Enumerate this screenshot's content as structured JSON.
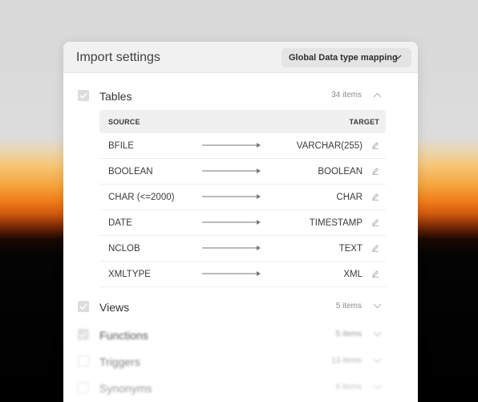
{
  "panel": {
    "title": "Import settings",
    "mapping_dropdown": "Global Data type mapping"
  },
  "sections": [
    {
      "name": "Tables",
      "count": "34 items",
      "checked": true,
      "expanded": true
    },
    {
      "name": "Views",
      "count": "5 items",
      "checked": true,
      "expanded": false
    },
    {
      "name": "Functions",
      "count": "5 items",
      "checked": true,
      "expanded": false
    },
    {
      "name": "Triggers",
      "count": "13 items",
      "checked": false,
      "expanded": false
    },
    {
      "name": "Synonyms",
      "count": "6 items",
      "checked": false,
      "expanded": false
    }
  ],
  "mapping_table": {
    "header_source": "SOURCE",
    "header_target": "TARGET",
    "rows": [
      {
        "source": "BFILE",
        "target": "VARCHAR(255)"
      },
      {
        "source": "BOOLEAN",
        "target": "BOOLEAN"
      },
      {
        "source": "CHAR (<=2000)",
        "target": "CHAR"
      },
      {
        "source": "DATE",
        "target": "TIMESTAMP"
      },
      {
        "source": "NCLOB",
        "target": "TEXT"
      },
      {
        "source": "XMLTYPE",
        "target": "XML"
      }
    ]
  },
  "icons": {
    "checkbox": "check-icon",
    "expand": "chevron-up-icon",
    "collapse": "chevron-down-icon",
    "mapping": "arrow-right-icon",
    "edit": "pencil-icon"
  }
}
